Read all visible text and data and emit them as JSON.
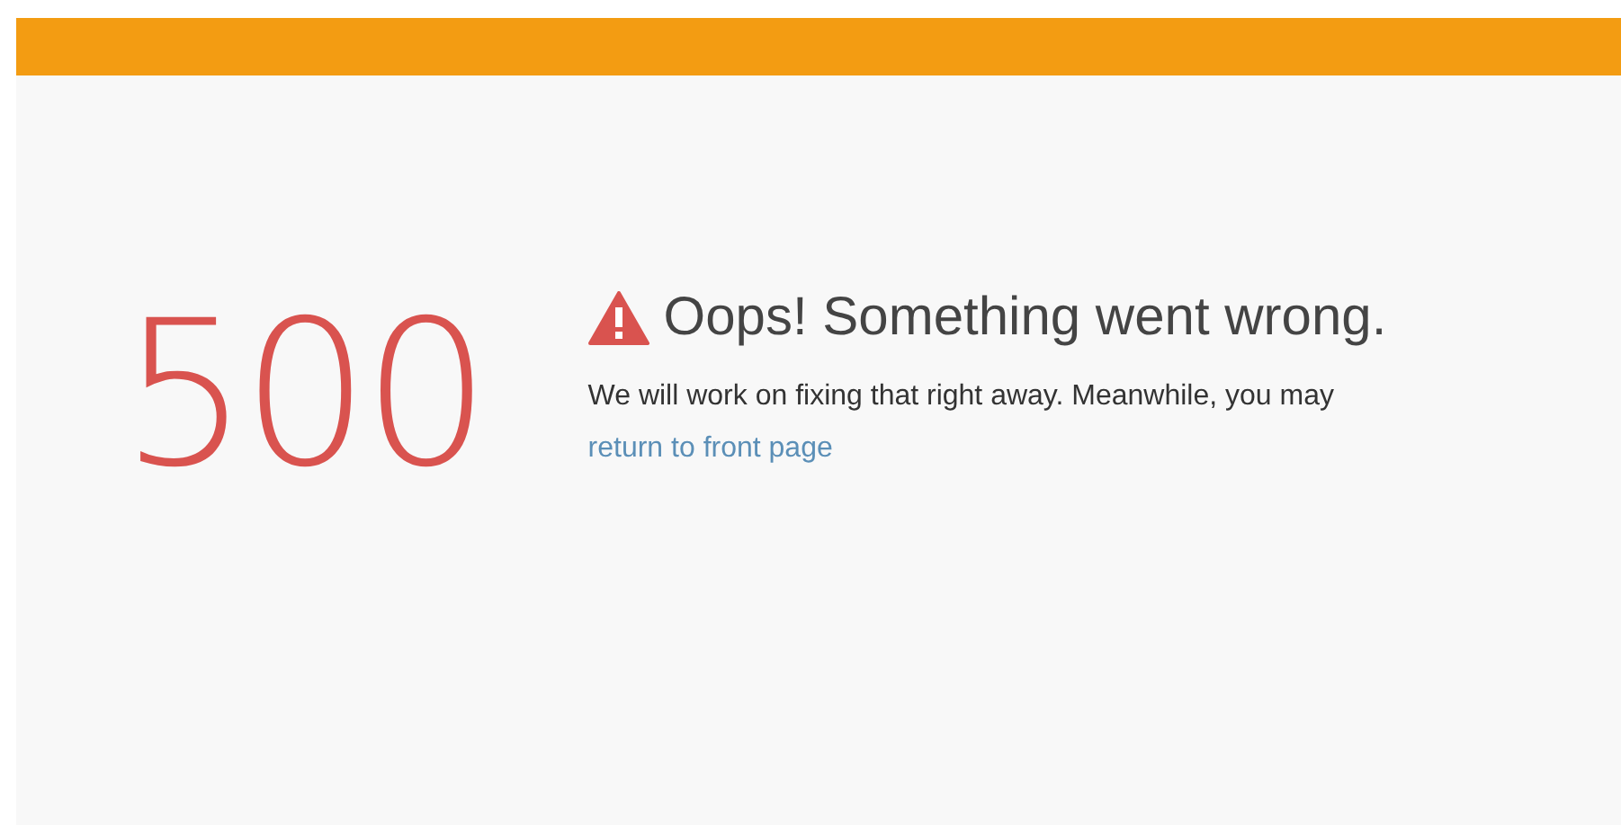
{
  "error": {
    "code": "500",
    "title": "Oops! Something went wrong.",
    "message": "We will work on fixing that right away. Meanwhile, you may",
    "link": "return to front page"
  }
}
